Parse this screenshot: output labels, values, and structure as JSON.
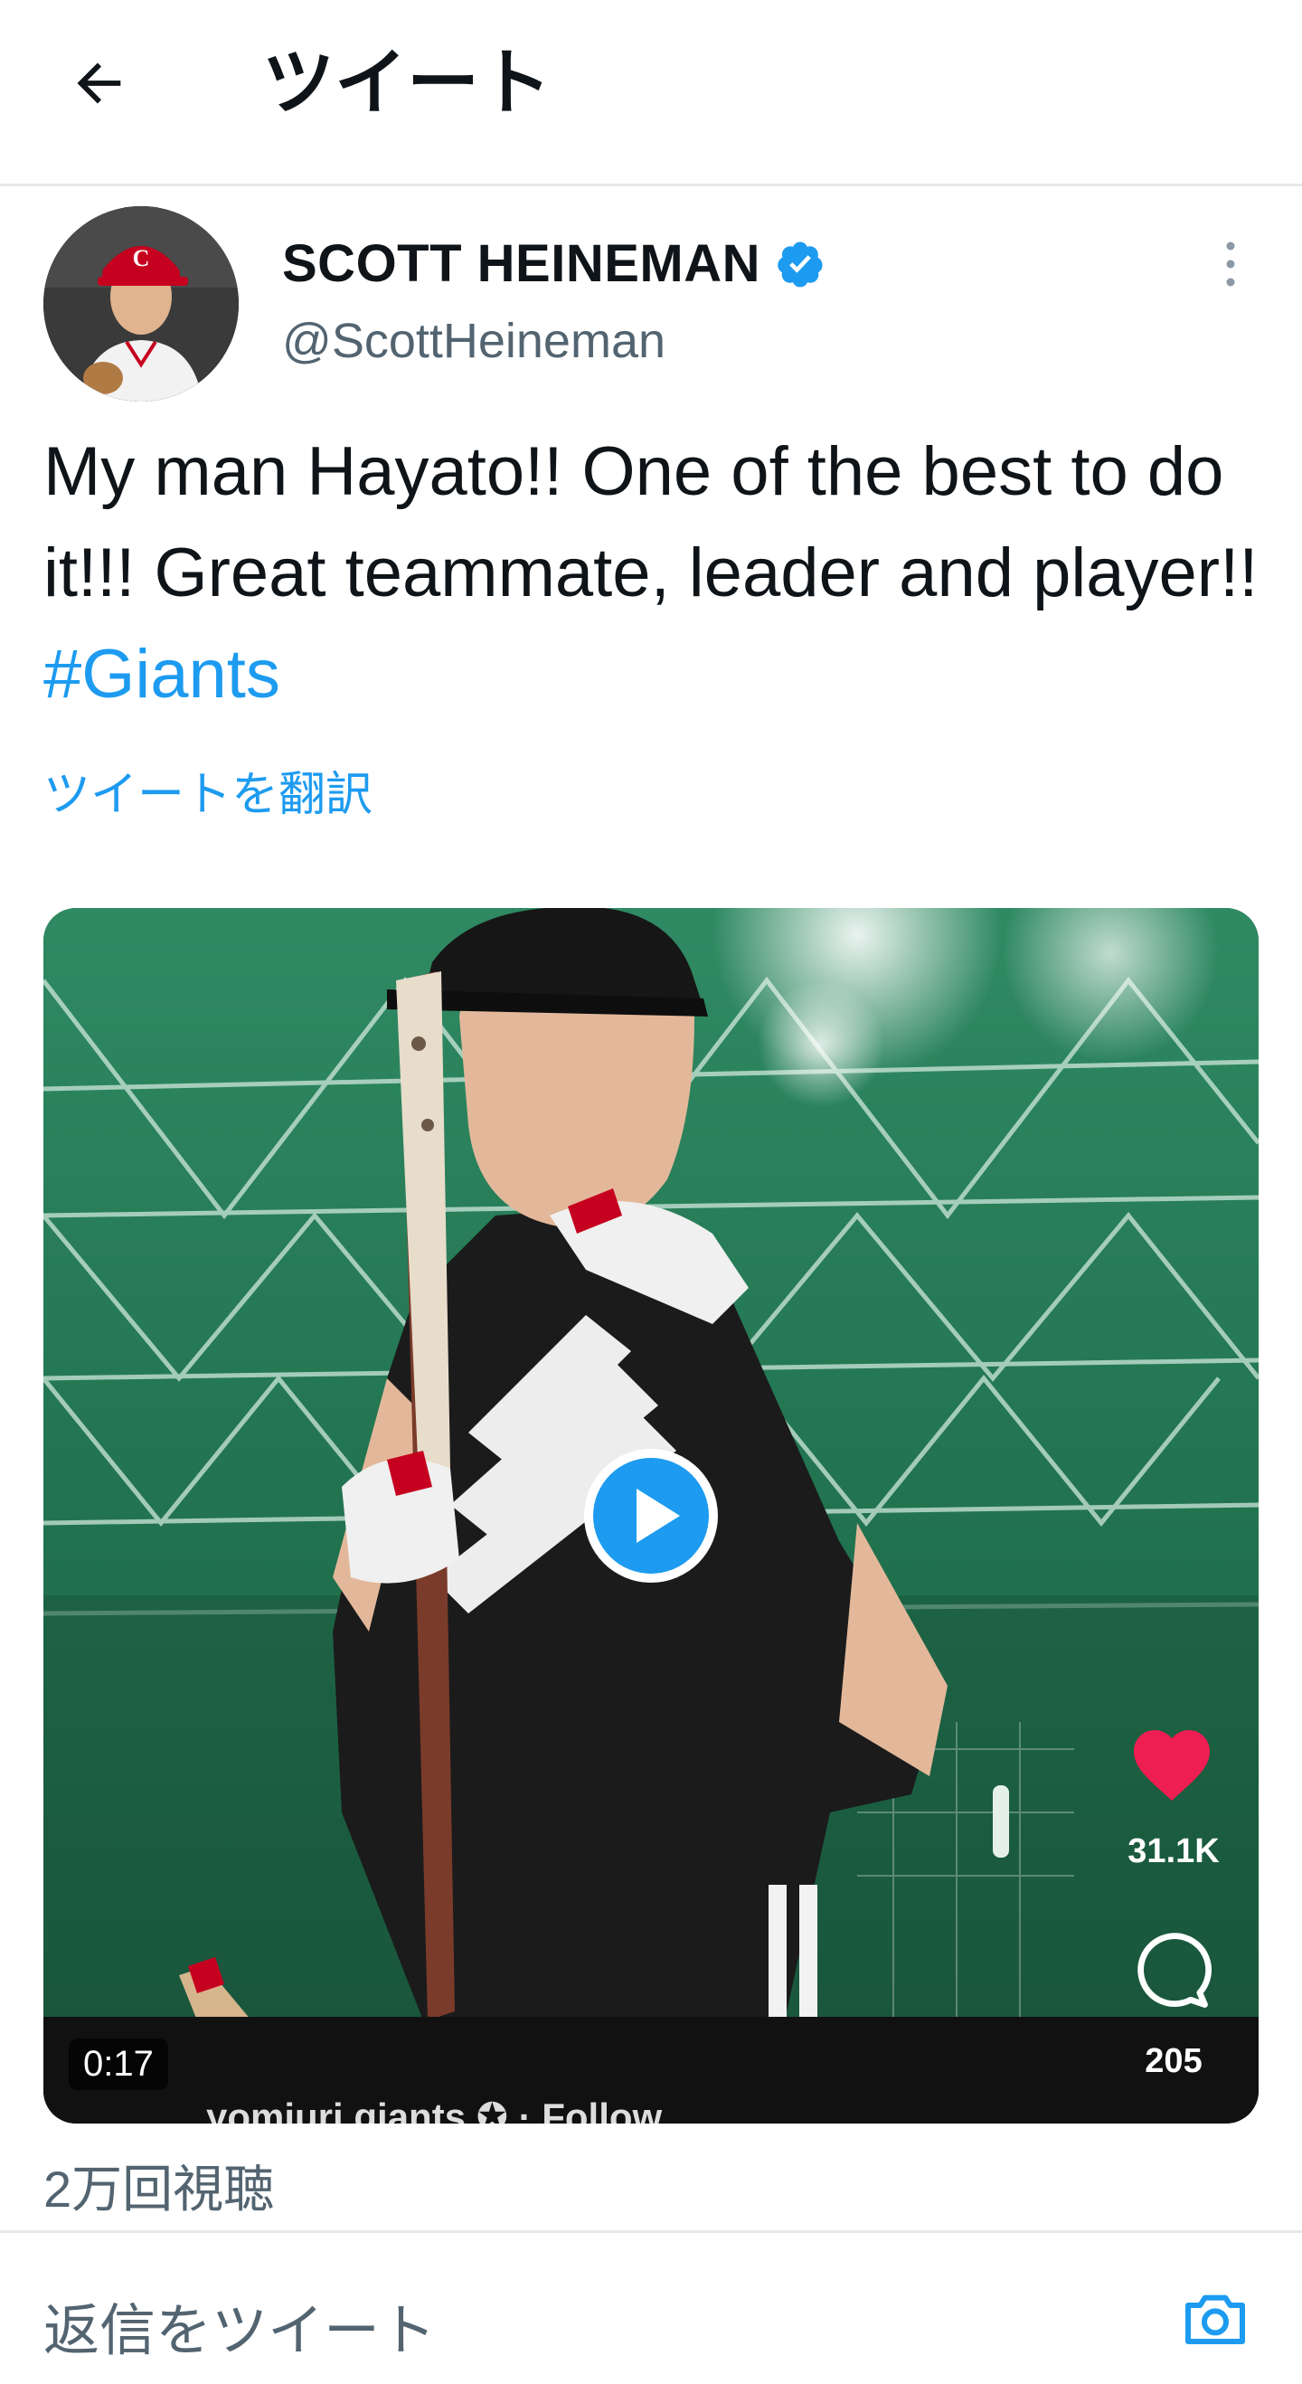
{
  "header": {
    "title": "ツイート",
    "back_icon": "arrow-left-icon"
  },
  "author": {
    "name": "SCOTT HEINEMAN",
    "handle": "@ScottHeineman",
    "verified": true,
    "verified_color": "#1d9bf0"
  },
  "tweet": {
    "text": "My man Hayato!! One of the best to do it!!! Great teammate, leader and player!! ",
    "hashtag": "#Giants",
    "translate_label": "ツイートを翻訳"
  },
  "video": {
    "duration": "0:17",
    "ig_like_count": "31.1K",
    "ig_comment_count": "205",
    "ig_username": "yomiuri.giants ✪ · Follow",
    "play_color": "#1d9bf0"
  },
  "stats": {
    "views": "2万回視聴"
  },
  "reply": {
    "placeholder": "返信をツイート",
    "camera_icon": "camera-icon"
  }
}
